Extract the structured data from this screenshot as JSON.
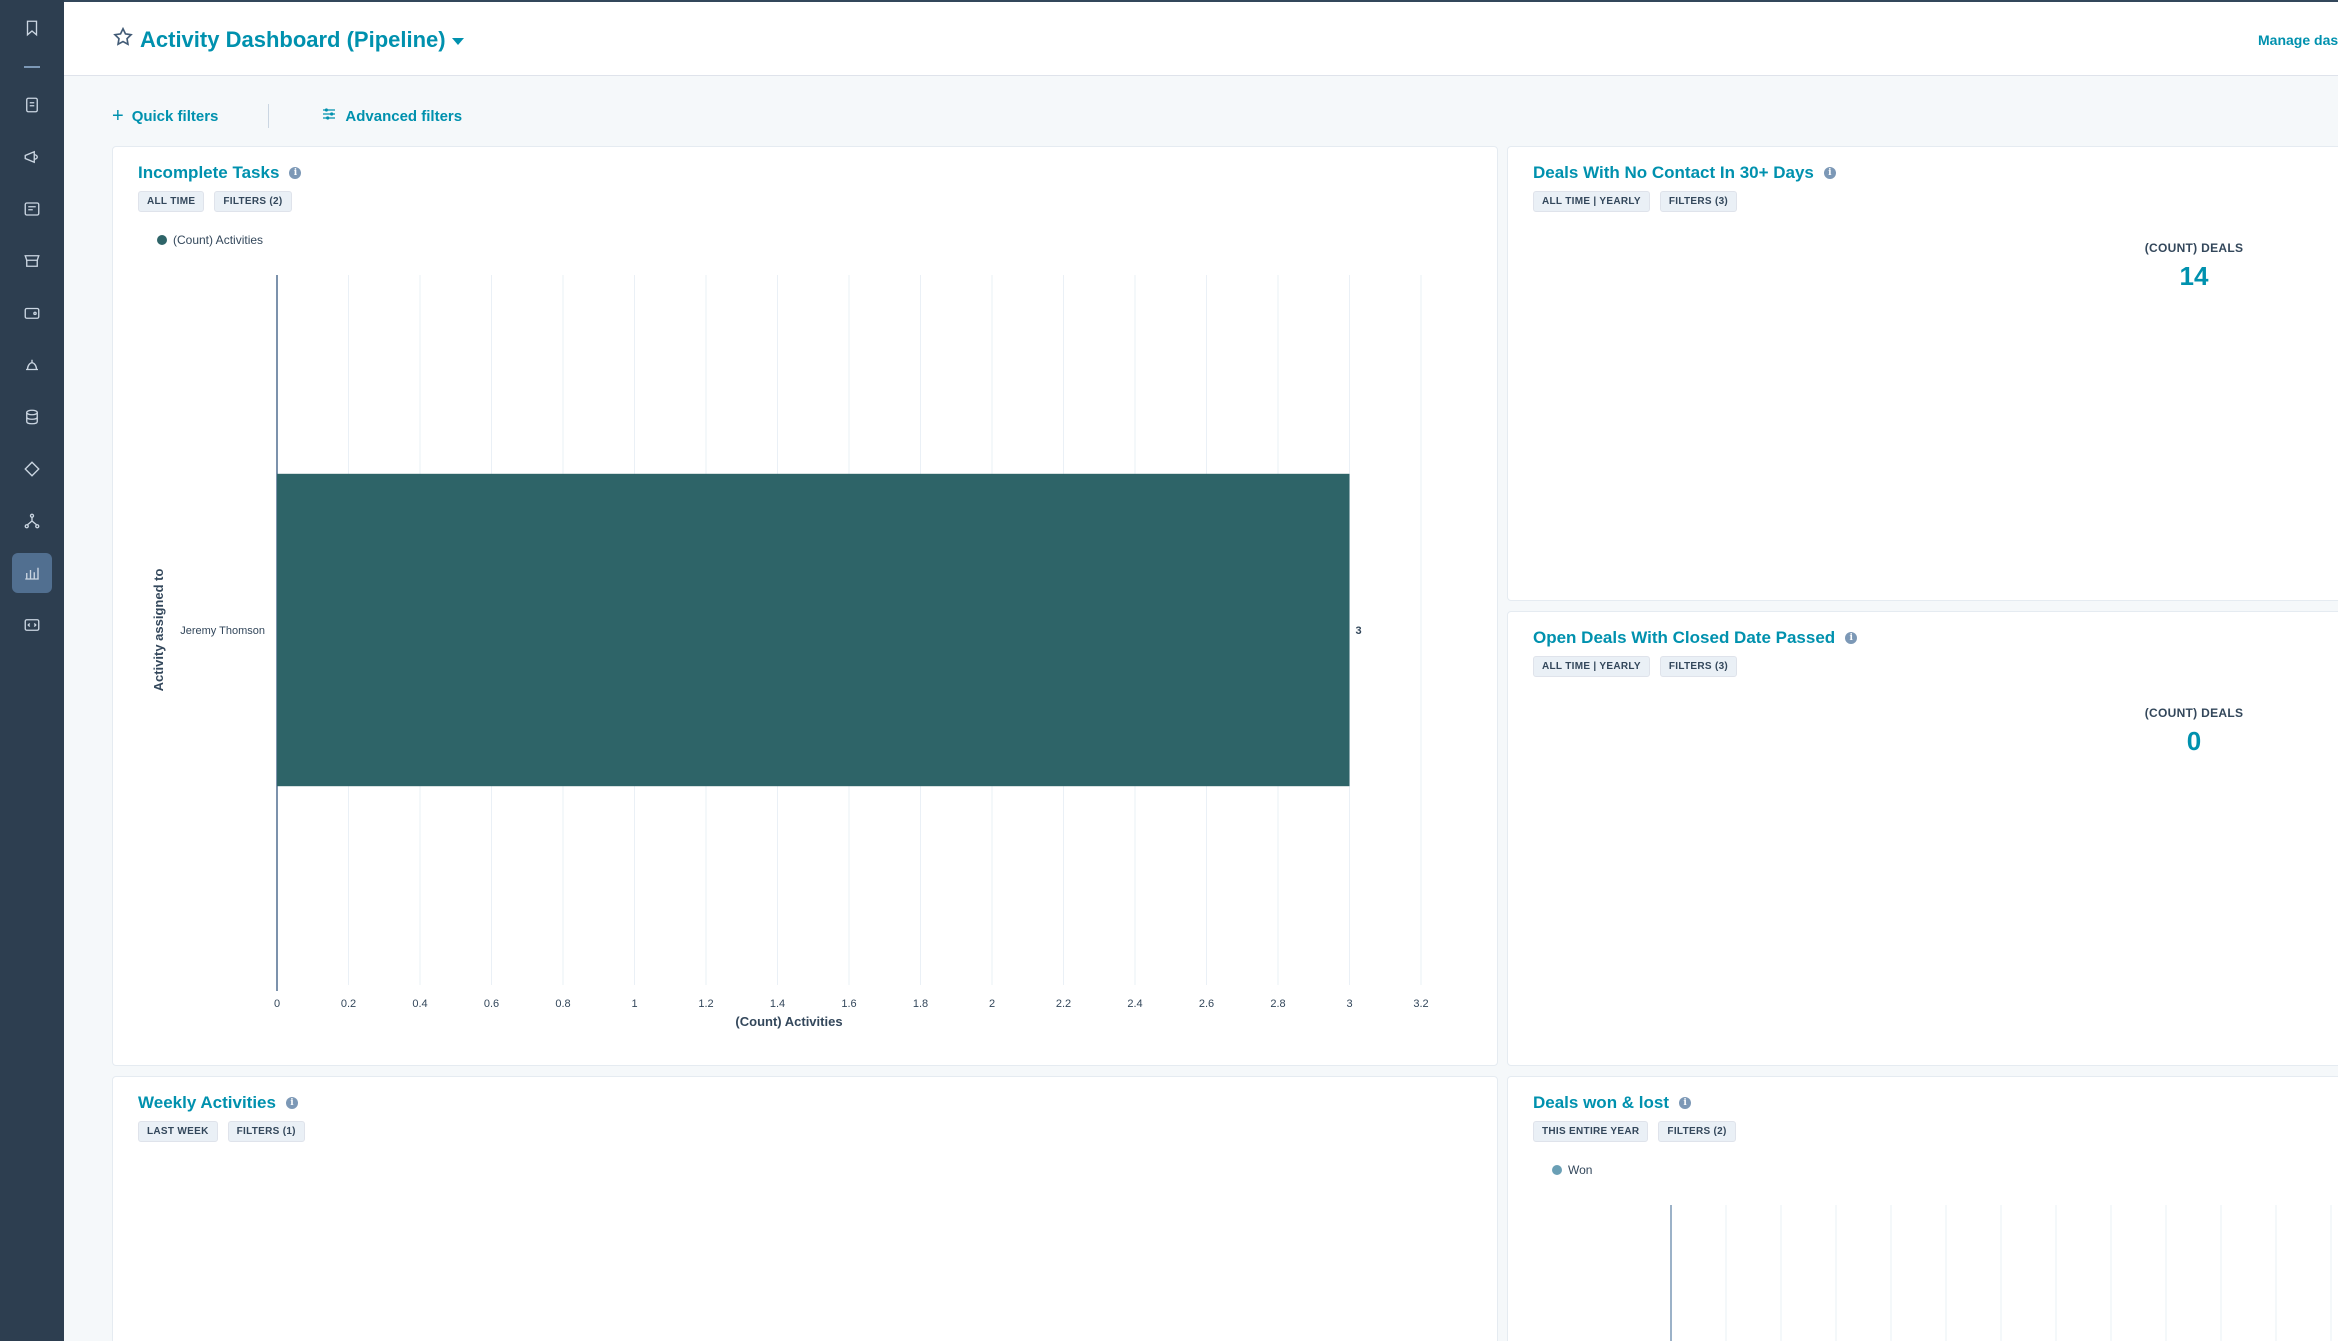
{
  "header": {
    "title": "Activity Dashboard (Pipeline)",
    "manage_label": "Manage dashboards"
  },
  "filters": {
    "quick_label": "Quick filters",
    "advanced_label": "Advanced filters"
  },
  "cards": {
    "incomplete_tasks": {
      "title": "Incomplete Tasks",
      "tags": [
        "ALL TIME",
        "FILTERS (2)"
      ],
      "legend": "(Count) Activities"
    },
    "no_contact": {
      "title": "Deals With No Contact In 30+ Days",
      "tags": [
        "ALL TIME | YEARLY",
        "FILTERS (3)"
      ],
      "metric_label": "(COUNT) DEALS",
      "metric_value": "14"
    },
    "closed_passed": {
      "title": "Open Deals With Closed Date Passed",
      "tags": [
        "ALL TIME | YEARLY",
        "FILTERS (3)"
      ],
      "metric_label": "(COUNT) DEALS",
      "metric_value": "0"
    },
    "weekly": {
      "title": "Weekly Activities",
      "tags": [
        "LAST WEEK",
        "FILTERS (1)"
      ]
    },
    "won_lost": {
      "title": "Deals won & lost",
      "tags": [
        "THIS ENTIRE YEAR",
        "FILTERS (2)"
      ],
      "legend": "Won"
    }
  },
  "chart_data": {
    "type": "bar",
    "orientation": "horizontal",
    "categories": [
      "Jeremy Thomson"
    ],
    "series": [
      {
        "name": "(Count) Activities",
        "values": [
          3
        ]
      }
    ],
    "xlabel": "(Count) Activities",
    "ylabel": "Activity assigned to",
    "xlim": [
      0,
      3.2
    ],
    "xticks": [
      "0",
      "0.2",
      "0.4",
      "0.6",
      "0.8",
      "1",
      "1.2",
      "1.4",
      "1.6",
      "1.8",
      "2",
      "2.2",
      "2.4",
      "2.6",
      "2.8",
      "3",
      "3.2"
    ],
    "data_labels": [
      "3"
    ],
    "grid": true,
    "legend": "top-left",
    "color": "#2e6468"
  },
  "colors": {
    "accent": "#0091ae",
    "nav_bg": "#2d3e50",
    "bar": "#2e6468",
    "won": "#6a9fb5"
  },
  "nav_icons": [
    "bookmark-icon",
    "contacts-icon",
    "megaphone-icon",
    "content-icon",
    "commerce-icon",
    "wallet-icon",
    "service-icon",
    "database-icon",
    "tag-icon",
    "workflow-icon",
    "reports-icon",
    "dev-icon"
  ]
}
